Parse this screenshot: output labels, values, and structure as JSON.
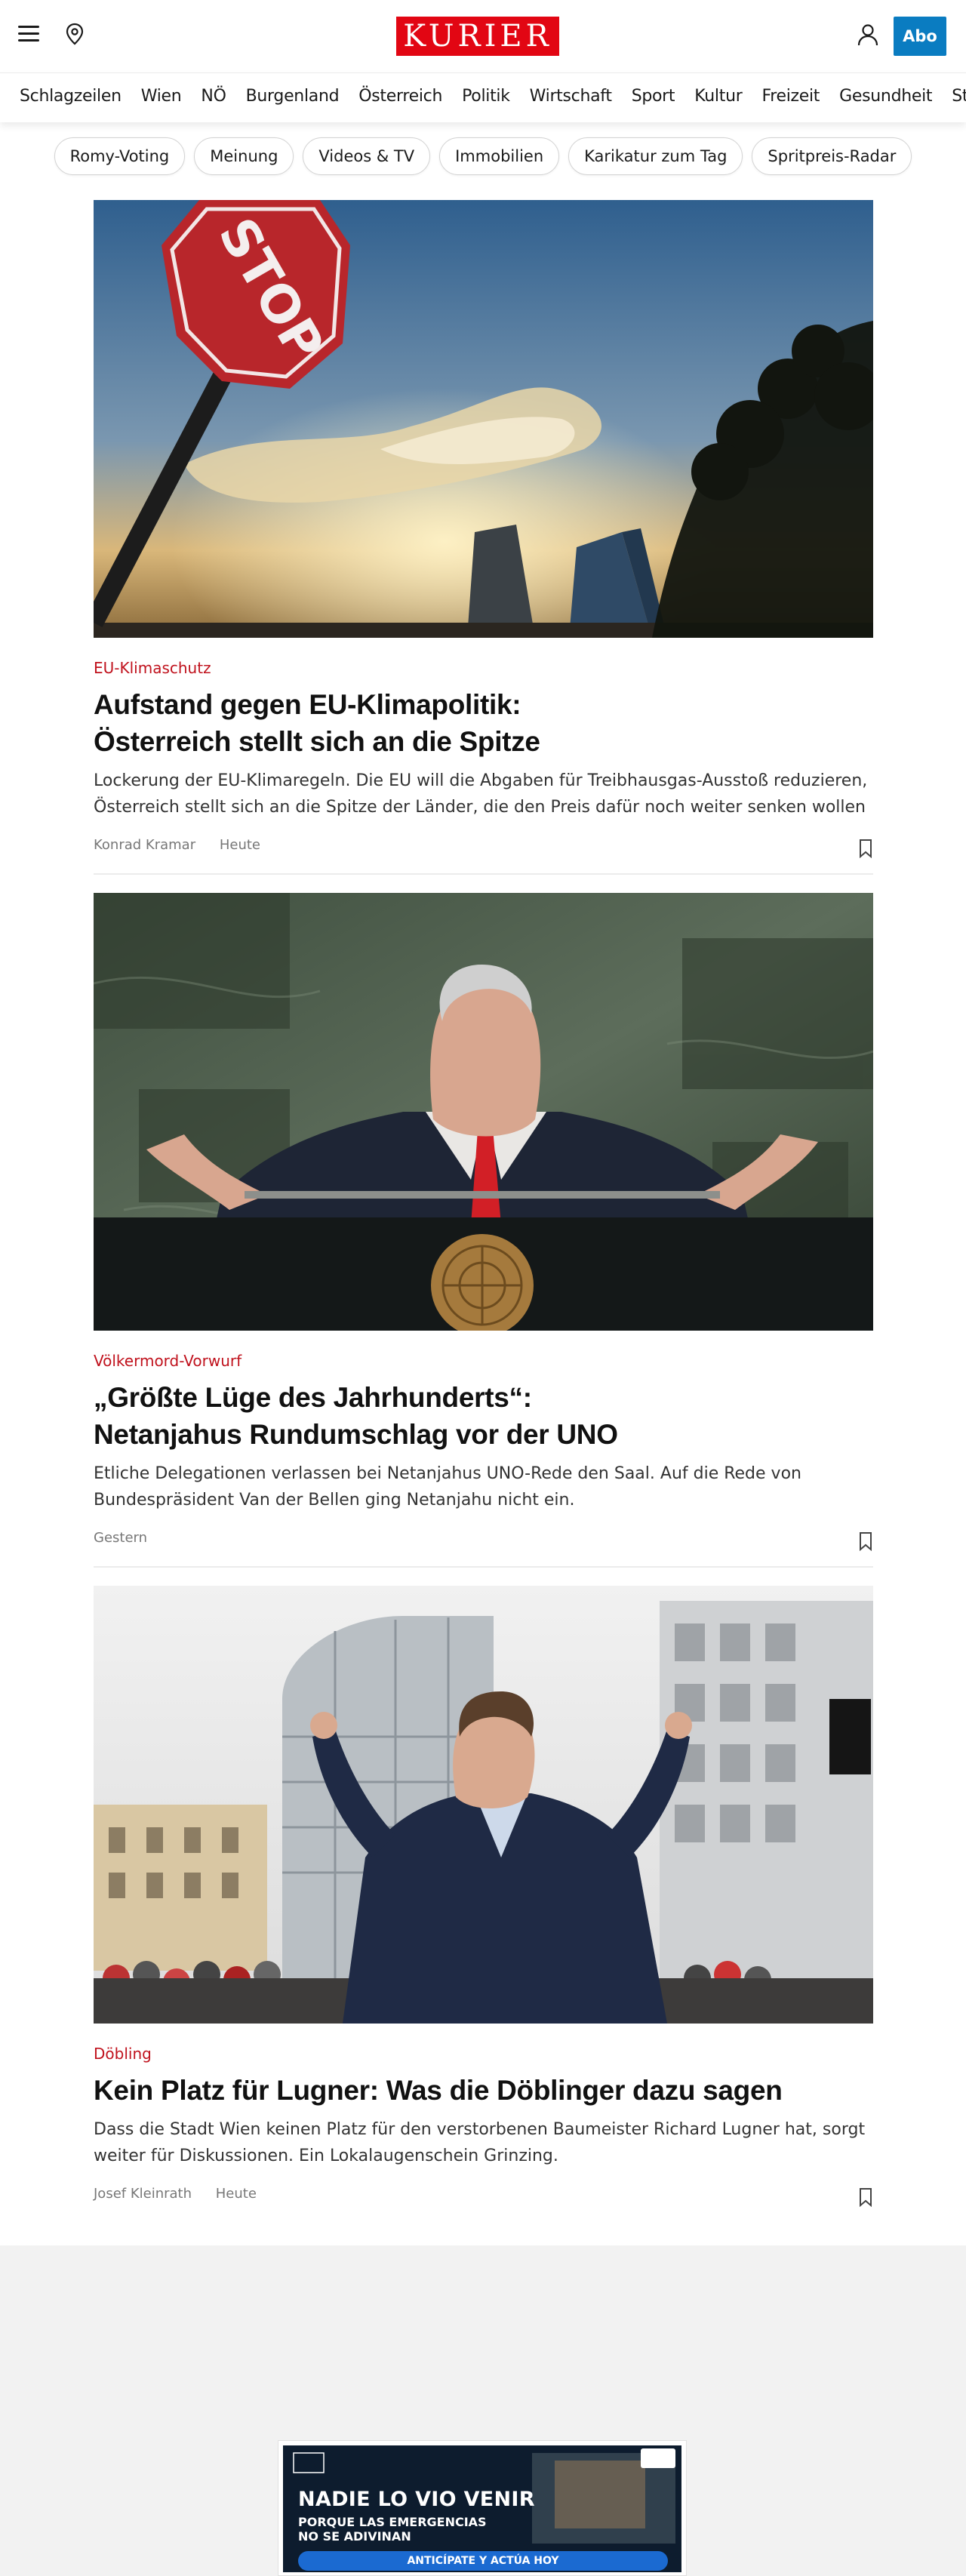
{
  "header": {
    "logo_text": "KURIER",
    "abo_label": "Abo",
    "icons": [
      "menu-icon",
      "location-pin-icon",
      "user-icon"
    ],
    "colors": {
      "brand": "#e20613",
      "abo": "#0a7cc1",
      "kicker": "#c0121d"
    }
  },
  "nav": {
    "items": [
      "Schlagzeilen",
      "Wien",
      "NÖ",
      "Burgenland",
      "Österreich",
      "Politik",
      "Wirtschaft",
      "Sport",
      "Kultur",
      "Freizeit",
      "Gesundheit",
      "Stars"
    ]
  },
  "chips": [
    "Romy-Voting",
    "Meinung",
    "Videos & TV",
    "Immobilien",
    "Karikatur zum Tag",
    "Spritpreis-Radar"
  ],
  "articles": [
    {
      "kicker": "EU-Klimaschutz",
      "headline_line1": "Aufstand gegen EU-Klimapolitik:",
      "headline_line2": "Österreich stellt sich an die Spitze",
      "teaser": "Lockerung der EU-Klimaregeln. Die EU will die Abgaben für Treibhausgas-Ausstoß reduzieren, Österreich stellt sich an die Spitze der Länder, die den Preis dafür noch weiter senken wollen",
      "author": "Konrad Kramar",
      "time": "Heute",
      "image_label": "STOP"
    },
    {
      "kicker": "Völkermord-Vorwurf",
      "headline_line1": "„Größte Lüge des Jahrhunderts“:",
      "headline_line2": "Netanjahus Rundumschlag vor der UNO",
      "teaser": "Etliche Delegationen verlassen bei Netanjahus UNO-Rede den Saal. Auf die Rede von Bundespräsident Van der Bellen ging Netanjahu nicht ein.",
      "author": "",
      "time": "Gestern"
    },
    {
      "kicker": "Döbling",
      "headline_line1": "Kein Platz für Lugner: Was die Döblinger dazu sagen",
      "headline_line2": "",
      "teaser": "Dass die Stadt Wien keinen Platz für den verstorbenen Baumeister Richard Lugner hat, sorgt weiter für Diskussionen. Ein Lokalaugenschein Grinzing.",
      "author": "Josef Kleinrath",
      "time": "Heute"
    }
  ],
  "ad": {
    "title": "NADIE LO VIO VENIR",
    "line1": "PORQUE LAS EMERGENCIAS",
    "line2": "NO SE ADIVINAN",
    "cta": "ANTICÍPATE Y ACTÚA HOY"
  }
}
